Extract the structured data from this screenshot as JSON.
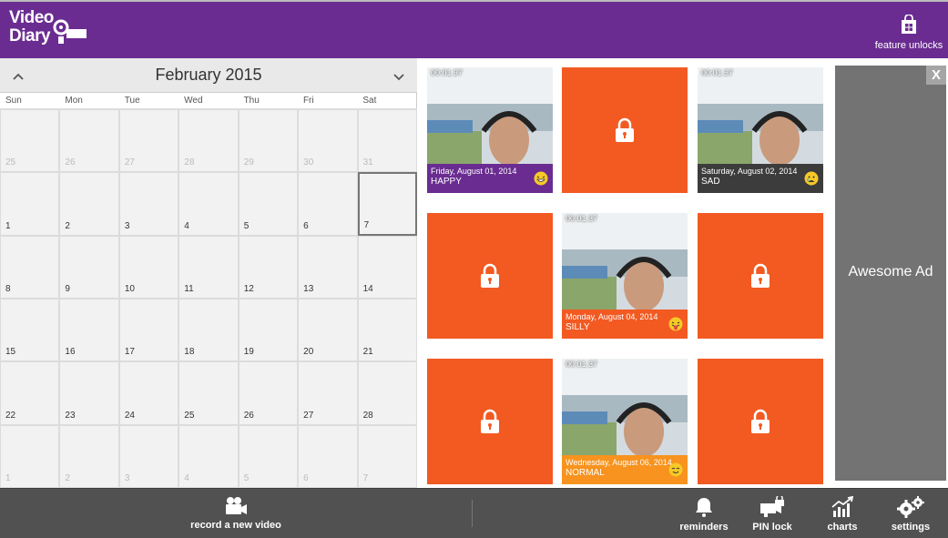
{
  "app": {
    "logo_line1": "Video",
    "logo_line2": "Diary"
  },
  "header": {
    "feature_unlocks_label": "feature unlocks"
  },
  "calendar": {
    "month_title": "February 2015",
    "weekdays": [
      "Sun",
      "Mon",
      "Tue",
      "Wed",
      "Thu",
      "Fri",
      "Sat"
    ],
    "days": [
      {
        "n": "25",
        "other": true
      },
      {
        "n": "26",
        "other": true
      },
      {
        "n": "27",
        "other": true
      },
      {
        "n": "28",
        "other": true
      },
      {
        "n": "29",
        "other": true
      },
      {
        "n": "30",
        "other": true
      },
      {
        "n": "31",
        "other": true
      },
      {
        "n": "1"
      },
      {
        "n": "2"
      },
      {
        "n": "3"
      },
      {
        "n": "4"
      },
      {
        "n": "5"
      },
      {
        "n": "6"
      },
      {
        "n": "7",
        "selected": true
      },
      {
        "n": "8"
      },
      {
        "n": "9"
      },
      {
        "n": "10"
      },
      {
        "n": "11"
      },
      {
        "n": "12"
      },
      {
        "n": "13"
      },
      {
        "n": "14"
      },
      {
        "n": "15"
      },
      {
        "n": "16"
      },
      {
        "n": "17"
      },
      {
        "n": "18"
      },
      {
        "n": "19"
      },
      {
        "n": "20"
      },
      {
        "n": "21"
      },
      {
        "n": "22"
      },
      {
        "n": "23"
      },
      {
        "n": "24"
      },
      {
        "n": "25"
      },
      {
        "n": "26"
      },
      {
        "n": "27"
      },
      {
        "n": "28"
      },
      {
        "n": "1",
        "other": true
      },
      {
        "n": "2",
        "other": true
      },
      {
        "n": "3",
        "other": true
      },
      {
        "n": "4",
        "other": true
      },
      {
        "n": "5",
        "other": true
      },
      {
        "n": "6",
        "other": true
      },
      {
        "n": "7",
        "other": true
      }
    ]
  },
  "entries": [
    {
      "duration": "00:01:37",
      "date": "Friday, August 01, 2014",
      "mood": "HAPPY",
      "caption_color": "#6a2c91",
      "emoji": "laughing-emoji-icon"
    },
    {
      "duration": "00:01:37",
      "date": "Saturday, August 02, 2014",
      "mood": "SAD",
      "caption_color": "#3c3c3c",
      "emoji": "crying-emoji-icon"
    },
    {
      "duration": "00:01:37",
      "date": "Monday, August 04, 2014",
      "mood": "SILLY",
      "caption_color": "#f25a22",
      "emoji": "tongue-emoji-icon"
    },
    {
      "duration": "00:01:37",
      "date": "Wednesday, August 06, 2014",
      "mood": "NORMAL",
      "caption_color": "#f7931e",
      "emoji": "smile-emoji-icon"
    }
  ],
  "ad": {
    "text": "Awesome Ad",
    "close": "X"
  },
  "bottombar": {
    "record_label": "record a new video",
    "reminders_label": "reminders",
    "pin_lock_label": "PIN lock",
    "charts_label": "charts",
    "settings_label": "settings"
  },
  "colors": {
    "header": "#6a2c91",
    "locked_tile": "#f25a22",
    "bottombar": "#515151"
  }
}
